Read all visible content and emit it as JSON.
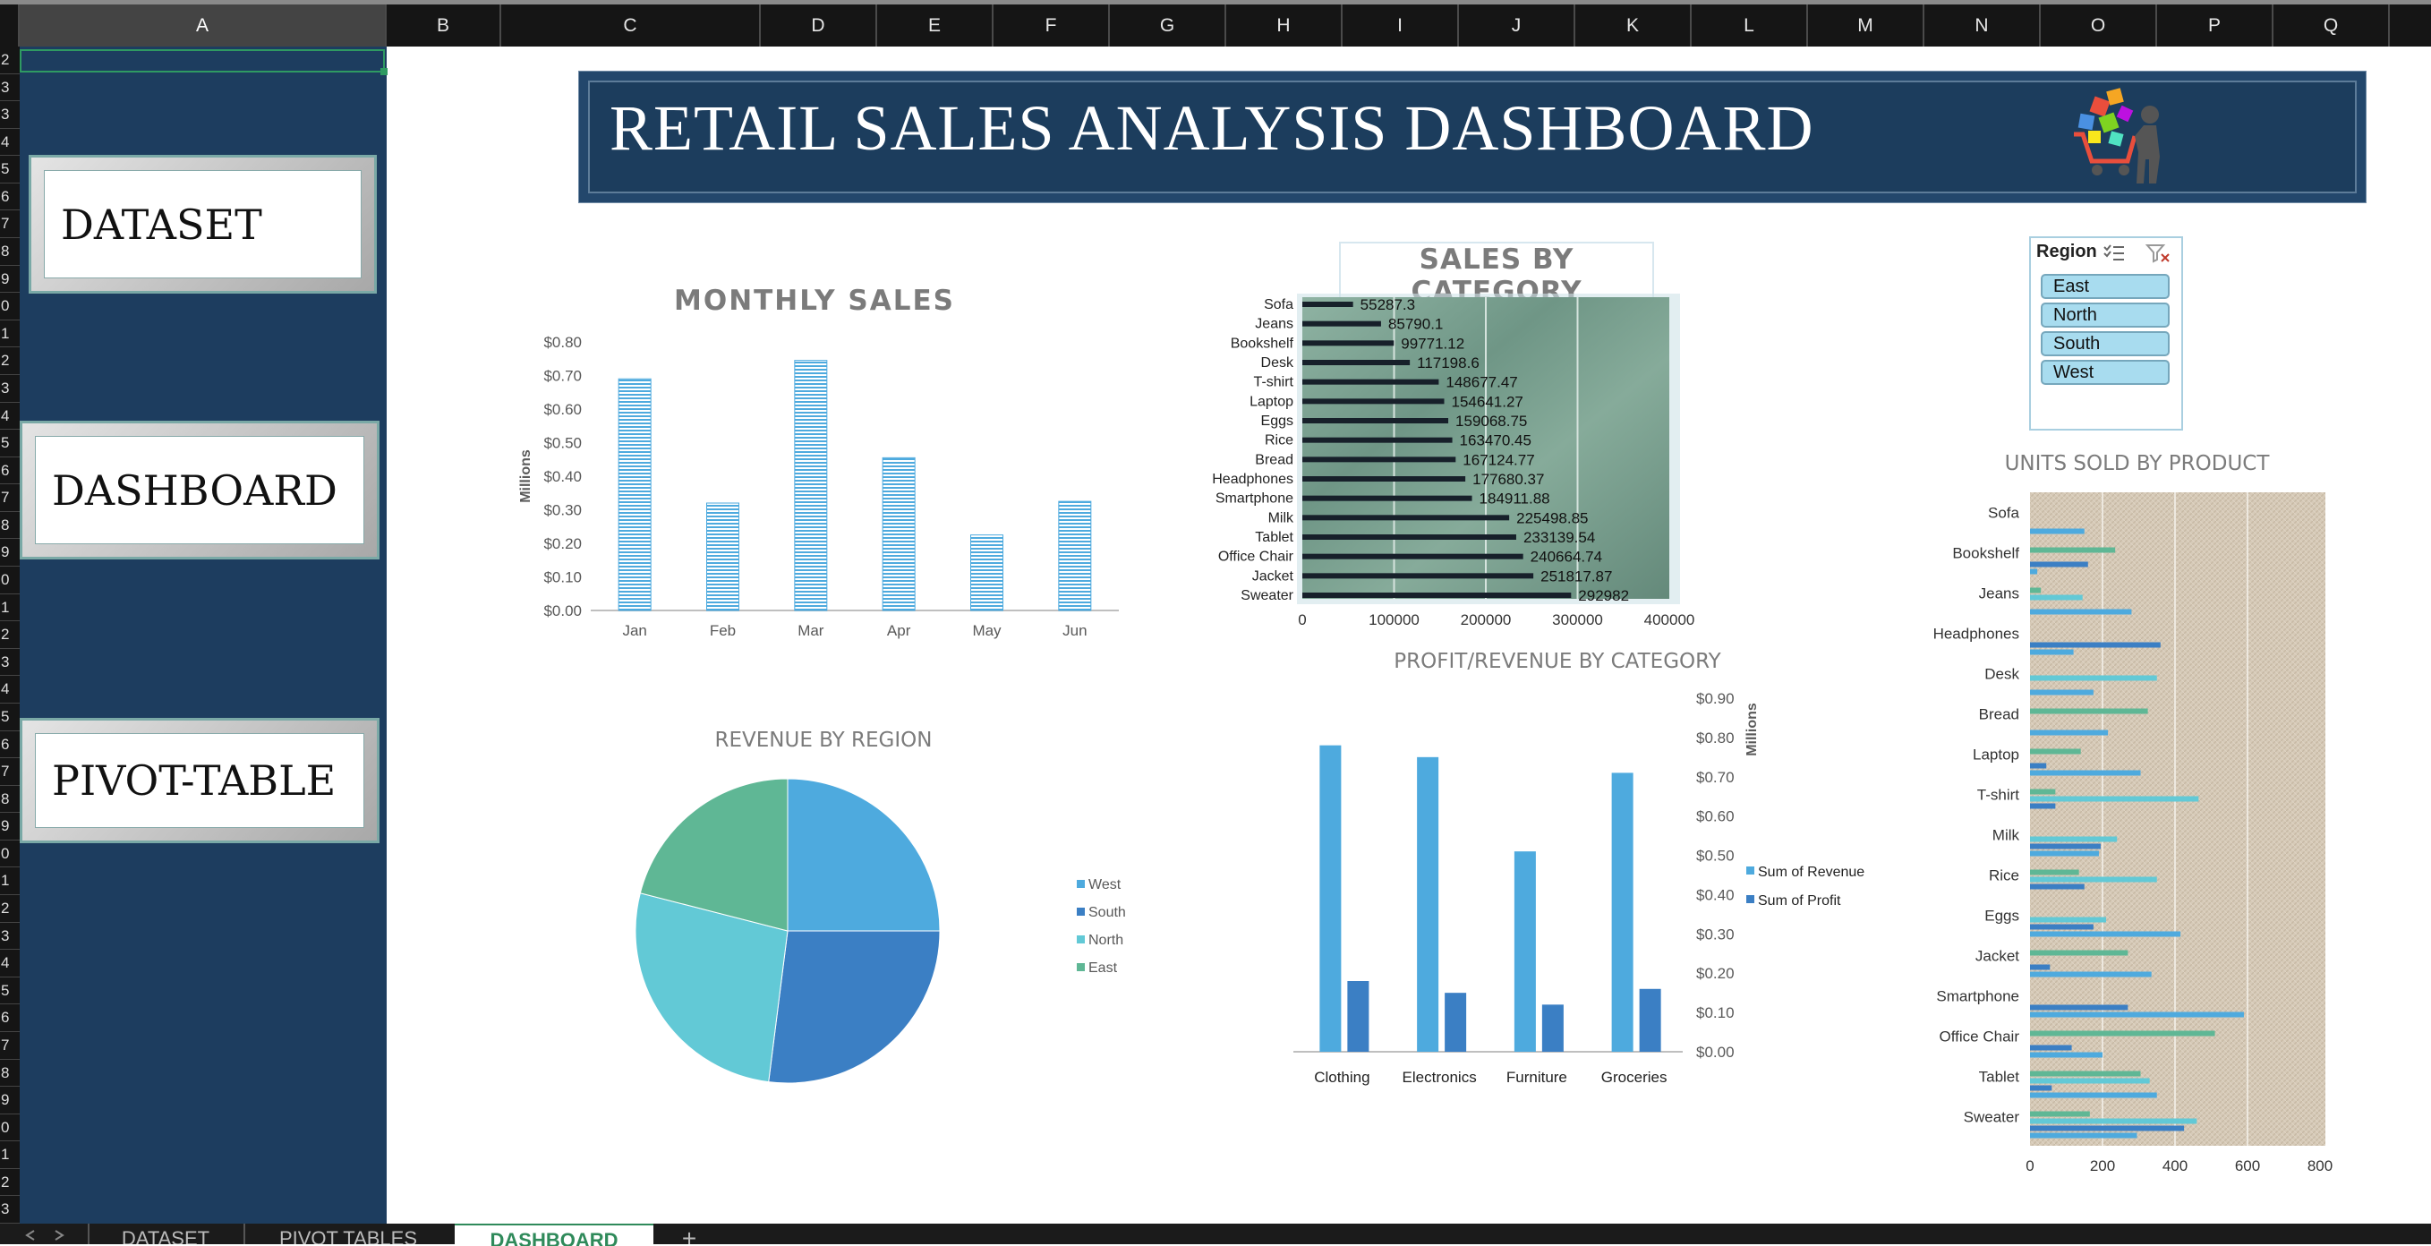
{
  "columns": [
    "A",
    "B",
    "C",
    "D",
    "E",
    "F",
    "G",
    "H",
    "I",
    "J",
    "K",
    "L",
    "M",
    "N",
    "O",
    "P",
    "Q"
  ],
  "rows": [
    "2",
    "3",
    "3",
    "4",
    "5",
    "6",
    "7",
    "8",
    "9",
    "0",
    "1",
    "2",
    "3",
    "4",
    "5",
    "6",
    "7",
    "8",
    "9",
    "0",
    "1",
    "2",
    "3",
    "4",
    "5",
    "6",
    "7",
    "8",
    "9",
    "0",
    "1",
    "2",
    "3",
    "4",
    "5",
    "6",
    "7",
    "8",
    "9",
    "0",
    "1",
    "2",
    "3"
  ],
  "nav": {
    "dataset": "DATASET",
    "dashboard": "DASHBOARD",
    "pivot": "PIVOT-TABLE"
  },
  "header": {
    "title": "RETAIL SALES ANALYSIS DASHBOARD",
    "logo_icon": "shopping-cart-icon"
  },
  "slicer": {
    "title": "Region",
    "items": [
      "East",
      "North",
      "South",
      "West"
    ]
  },
  "tabs": [
    "DATASET",
    "PIVOT TABLES",
    "DASHBOARD",
    "+"
  ],
  "colors": {
    "navy": "#1d3d5f",
    "lightblue": "#4eaade",
    "blue": "#3b7fc4",
    "teal": "#62c9d6",
    "green": "#5fb795"
  },
  "chart_data": [
    {
      "id": "monthly",
      "type": "bar",
      "title": "MONTHLY SALES",
      "ylabel": "Millions",
      "categories": [
        "Jan",
        "Feb",
        "Mar",
        "Apr",
        "May",
        "Jun"
      ],
      "values": [
        0.69,
        0.32,
        0.745,
        0.455,
        0.225,
        0.325
      ],
      "ylim": [
        0,
        0.8
      ],
      "yticks": [
        "$0.00",
        "$0.10",
        "$0.20",
        "$0.30",
        "$0.40",
        "$0.50",
        "$0.60",
        "$0.70",
        "$0.80"
      ]
    },
    {
      "id": "category",
      "type": "bar",
      "title": "SALES BY CATEGORY",
      "categories": [
        "Sofa",
        "Jeans",
        "Bookshelf",
        "Desk",
        "T-shirt",
        "Laptop",
        "Eggs",
        "Rice",
        "Bread",
        "Headphones",
        "Smartphone",
        "Milk",
        "Tablet",
        "Office Chair",
        "Jacket",
        "Sweater"
      ],
      "values": [
        55287.3,
        85790.1,
        99771.12,
        117198.6,
        148677.47,
        154641.27,
        159068.75,
        163470.45,
        167124.77,
        177680.37,
        184911.88,
        225498.85,
        233139.54,
        240664.74,
        251817.87,
        292982
      ],
      "labels": [
        "55287.3",
        "85790.1",
        "99771.12",
        "117198.6",
        "148677.47",
        "154641.27",
        "159068.75",
        "163470.45",
        "167124.77",
        "177680.37",
        "184911.88",
        "225498.85",
        "233139.54",
        "240664.74",
        "251817.87",
        "292982"
      ],
      "xticks": [
        "0",
        "100000",
        "200000",
        "300000",
        "400000"
      ],
      "xlim": [
        0,
        400000
      ]
    },
    {
      "id": "region",
      "type": "pie",
      "title": "REVENUE BY REGION",
      "categories": [
        "West",
        "South",
        "North",
        "East"
      ],
      "values": [
        25,
        27,
        27,
        21
      ]
    },
    {
      "id": "profit",
      "type": "bar",
      "title": "PROFIT/REVENUE BY CATEGORY",
      "ylabel": "Millions",
      "categories": [
        "Clothing",
        "Electronics",
        "Furniture",
        "Groceries"
      ],
      "series": [
        {
          "name": "Sum of Revenue",
          "values": [
            0.78,
            0.75,
            0.51,
            0.71
          ]
        },
        {
          "name": "Sum of Profit",
          "values": [
            0.18,
            0.15,
            0.12,
            0.16
          ]
        }
      ],
      "ylim": [
        0,
        0.9
      ],
      "yticks": [
        "$0.00",
        "$0.10",
        "$0.20",
        "$0.30",
        "$0.40",
        "$0.50",
        "$0.60",
        "$0.70",
        "$0.80",
        "$0.90"
      ]
    },
    {
      "id": "units",
      "type": "bar",
      "title": "UNITS SOLD BY PRODUCT",
      "categories": [
        "Sofa",
        "Bookshelf",
        "Jeans",
        "Headphones",
        "Desk",
        "Bread",
        "Laptop",
        "T-shirt",
        "Milk",
        "Rice",
        "Eggs",
        "Jacket",
        "Smartphone",
        "Office Chair",
        "Tablet",
        "Sweater"
      ],
      "series": [
        {
          "name": "East",
          "values": [
            0,
            235,
            30,
            0,
            0,
            325,
            140,
            70,
            0,
            135,
            0,
            270,
            0,
            510,
            305,
            165
          ]
        },
        {
          "name": "North",
          "values": [
            0,
            0,
            145,
            0,
            350,
            0,
            0,
            465,
            240,
            350,
            210,
            0,
            0,
            0,
            330,
            460
          ]
        },
        {
          "name": "South",
          "values": [
            0,
            160,
            0,
            360,
            0,
            0,
            45,
            70,
            195,
            150,
            175,
            55,
            270,
            115,
            60,
            425
          ]
        },
        {
          "name": "West",
          "values": [
            150,
            20,
            280,
            120,
            175,
            215,
            305,
            0,
            190,
            0,
            415,
            335,
            590,
            200,
            350,
            295
          ]
        }
      ],
      "xticks": [
        "0",
        "200",
        "400",
        "600",
        "800"
      ],
      "xlim": [
        0,
        800
      ]
    }
  ]
}
